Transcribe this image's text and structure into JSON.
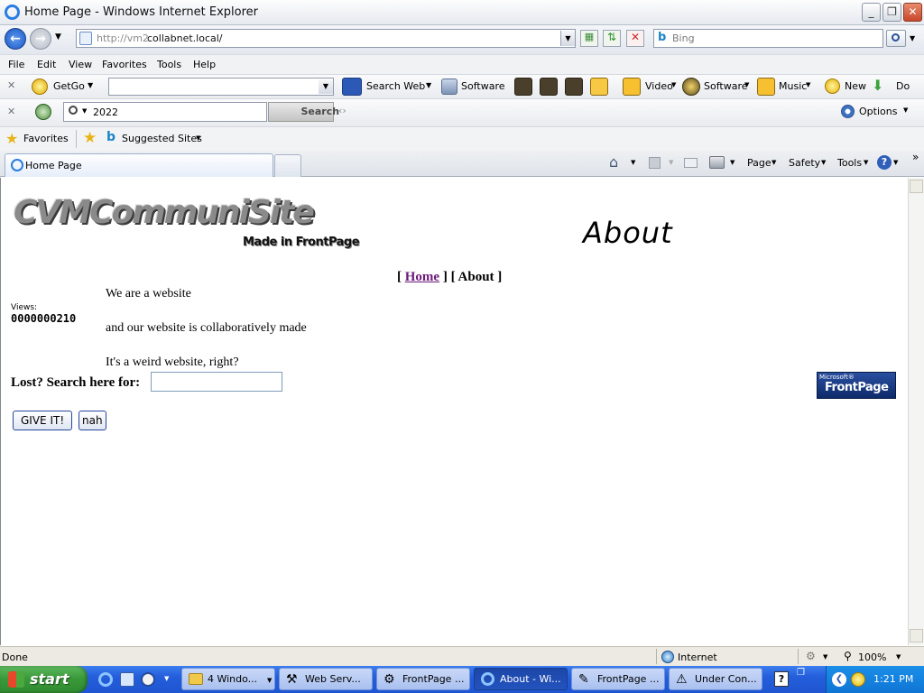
{
  "window": {
    "title": "Home Page - Windows Internet Explorer",
    "minimize": "_",
    "restore": "❐",
    "close": "✕"
  },
  "address": {
    "url_prefix": "http://vm2.",
    "url_host": "collabnet.local/",
    "search_placeholder": "Bing"
  },
  "menu": [
    "File",
    "Edit",
    "View",
    "Favorites",
    "Tools",
    "Help"
  ],
  "toolbar1": {
    "getgo": "GetGo",
    "search_web": "Search Web",
    "software": "Software",
    "video": "Video",
    "software2": "Software",
    "music": "Music",
    "new": "New",
    "do": "Do"
  },
  "toolbar2": {
    "search_value": "2022",
    "search_button": "Search",
    "options": "Options"
  },
  "favorites": {
    "favorites_label": "Favorites",
    "suggested": "Suggested Sites"
  },
  "tab": {
    "title": "Home Page"
  },
  "commandbar": {
    "page": "Page",
    "safety": "Safety",
    "tools": "Tools"
  },
  "page": {
    "logo_main": "CVMCommuniSite",
    "logo_sub": "Made in FrontPage",
    "heading": "About",
    "nav_open": "[",
    "nav_home": "Home",
    "nav_mid": "] [",
    "nav_about": "About",
    "nav_close": "]",
    "views_label": "Views:",
    "views_count": "0000000210",
    "line1": "We are a website",
    "line2": "and our website is collaboratively made",
    "line3": "It's a weird website, right?",
    "search_label": "Lost? Search here for:",
    "submit_button": "GIVE IT!",
    "reset_button": "nah",
    "badge_small": "Microsoft®",
    "badge_big": "FrontPage"
  },
  "status": {
    "text": "Done",
    "zone": "Internet",
    "zoom": "100%"
  },
  "taskbar": {
    "start": "start",
    "tasks": [
      "4 Windo...",
      "Web Serv...",
      "FrontPage ...",
      "About - Wi...",
      "FrontPage ...",
      "Under Con..."
    ],
    "clock": "1:21 PM"
  }
}
